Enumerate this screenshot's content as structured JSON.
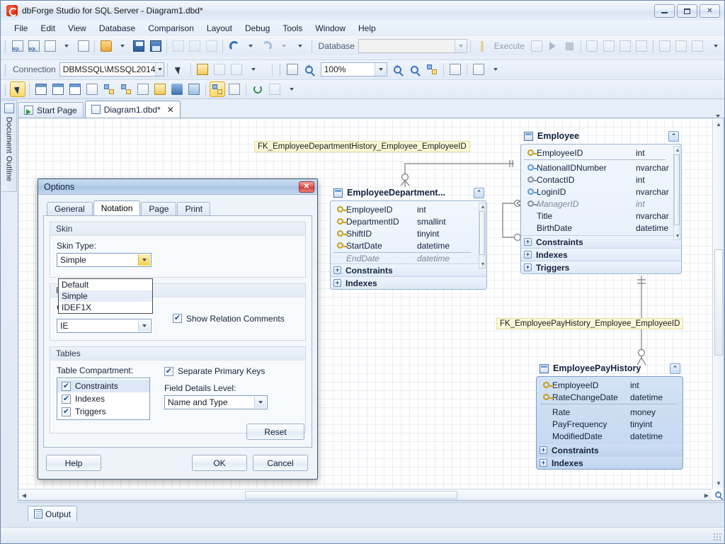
{
  "window": {
    "title": "dbForge Studio for SQL Server - Diagram1.dbd*",
    "minimize": "Minimize",
    "maximize": "Maximize",
    "close": "Close"
  },
  "menu": [
    "File",
    "Edit",
    "View",
    "Database",
    "Comparison",
    "Layout",
    "Debug",
    "Tools",
    "Window",
    "Help"
  ],
  "toolbar_main": {
    "database_label": "Database",
    "database_value": "",
    "execute_label": "Execute"
  },
  "toolbar_connection": {
    "connection_label": "Connection",
    "connection_value": "DBMSSQL\\MSSQL2014",
    "zoom_value": "100%"
  },
  "left_dock": {
    "document_outline": "Document Outline"
  },
  "doc_tabs": [
    {
      "label": "Start Page",
      "active": false,
      "closable": false
    },
    {
      "label": "Diagram1.dbd*",
      "active": true,
      "closable": true
    }
  ],
  "diagram": {
    "relations": [
      {
        "label": "FK_EmployeeDepartmentHistory_Employee_EmployeeID"
      },
      {
        "label": "FK_EmployeePayHistory_Employee_EmployeeID"
      }
    ],
    "tables": [
      {
        "name": "Employee",
        "selected": false,
        "fields": [
          {
            "name": "EmployeeID",
            "type": "int",
            "key": "pk",
            "nullable": false
          },
          {
            "name": "NationalIDNumber",
            "type": "nvarchar",
            "key": "blue",
            "nullable": false
          },
          {
            "name": "ContactID",
            "type": "int",
            "key": "fk",
            "nullable": false
          },
          {
            "name": "LoginID",
            "type": "nvarchar",
            "key": "blue",
            "nullable": false
          },
          {
            "name": "ManagerID",
            "type": "int",
            "key": "fk",
            "nullable": true
          },
          {
            "name": "Title",
            "type": "nvarchar",
            "key": "none",
            "nullable": false
          },
          {
            "name": "BirthDate",
            "type": "datetime",
            "key": "none",
            "nullable": false
          }
        ],
        "compartments": [
          "Constraints",
          "Indexes",
          "Triggers"
        ]
      },
      {
        "name": "EmployeeDepartment...",
        "selected": false,
        "fields": [
          {
            "name": "EmployeeID",
            "type": "int",
            "key": "pkfk",
            "nullable": false
          },
          {
            "name": "DepartmentID",
            "type": "smallint",
            "key": "pkfk",
            "nullable": false
          },
          {
            "name": "ShiftID",
            "type": "tinyint",
            "key": "pkfk",
            "nullable": false
          },
          {
            "name": "StartDate",
            "type": "datetime",
            "key": "pk",
            "nullable": false
          },
          {
            "name": "EndDate",
            "type": "datetime",
            "key": "none",
            "nullable": true,
            "clipped": true
          }
        ],
        "compartments": [
          "Constraints",
          "Indexes"
        ]
      },
      {
        "name": "EmployeePayHistory",
        "selected": true,
        "fields": [
          {
            "name": "EmployeeID",
            "type": "int",
            "key": "pkfk",
            "nullable": false
          },
          {
            "name": "RateChangeDate",
            "type": "datetime",
            "key": "pk",
            "nullable": false
          },
          {
            "name": "Rate",
            "type": "money",
            "key": "none",
            "nullable": false
          },
          {
            "name": "PayFrequency",
            "type": "tinyint",
            "key": "none",
            "nullable": false
          },
          {
            "name": "ModifiedDate",
            "type": "datetime",
            "key": "none",
            "nullable": false
          }
        ],
        "compartments": [
          "Constraints",
          "Indexes"
        ]
      }
    ]
  },
  "options_dialog": {
    "title": "Options",
    "tabs": [
      "General",
      "Notation",
      "Page",
      "Print"
    ],
    "active_tab": "Notation",
    "skin_group": {
      "title": "Skin",
      "skin_type_label": "Skin Type:",
      "skin_type_value": "Simple",
      "skin_type_options": [
        "Default",
        "Simple",
        "IDEF1X"
      ],
      "skin_type_selected": "Simple"
    },
    "relations_group": {
      "title": "Relations",
      "cardinality_label": "Cardinality Notation:",
      "cardinality_value": "IE",
      "show_relation_comments_label": "Show Relation Comments",
      "show_relation_comments_checked": true
    },
    "tables_group": {
      "title": "Tables",
      "table_compartment_label": "Table Compartment:",
      "compartments": [
        {
          "label": "Constraints",
          "checked": true,
          "selected": true
        },
        {
          "label": "Indexes",
          "checked": true,
          "selected": false
        },
        {
          "label": "Triggers",
          "checked": true,
          "selected": false
        }
      ],
      "separate_primary_keys_label": "Separate Primary Keys",
      "separate_primary_keys_checked": true,
      "field_details_level_label": "Field Details Level:",
      "field_details_level_value": "Name and Type"
    },
    "reset_label": "Reset",
    "help_label": "Help",
    "ok_label": "OK",
    "cancel_label": "Cancel"
  },
  "output_dock": {
    "tab_label": "Output"
  }
}
